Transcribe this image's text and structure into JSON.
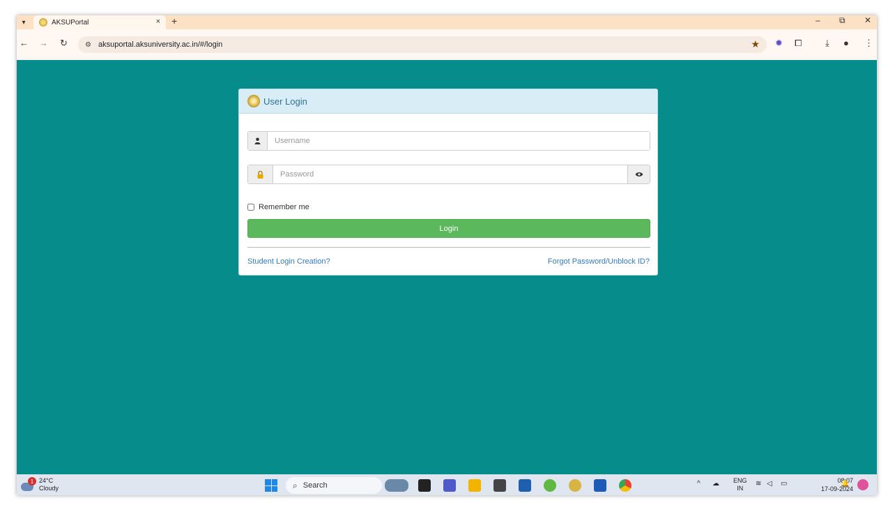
{
  "browser": {
    "tab_title": "AKSUPortal",
    "tab_close": "×",
    "new_tab": "+",
    "url": "aksuportal.aksuniversity.ac.in/#/login",
    "window_minimize": "–",
    "window_restore": "⧉",
    "window_close": "✕"
  },
  "login": {
    "panel_title": "User Login",
    "username_placeholder": "Username",
    "password_placeholder": "Password",
    "remember_label": "Remember me",
    "login_button": "Login",
    "student_link": "Student Login Creation?",
    "forgot_link": "Forgot Password/Unblock ID?"
  },
  "taskbar": {
    "weather_badge": "1",
    "temperature": "24°C",
    "condition": "Cloudy",
    "search_label": "Search",
    "lang_top": "ENG",
    "lang_bottom": "IN",
    "time": "08:07",
    "date": "17-09-2024"
  },
  "colors": {
    "page_bg": "#078c8c",
    "login_button": "#5cb85c",
    "panel_header": "#d9edf7",
    "link": "#337ab7"
  }
}
